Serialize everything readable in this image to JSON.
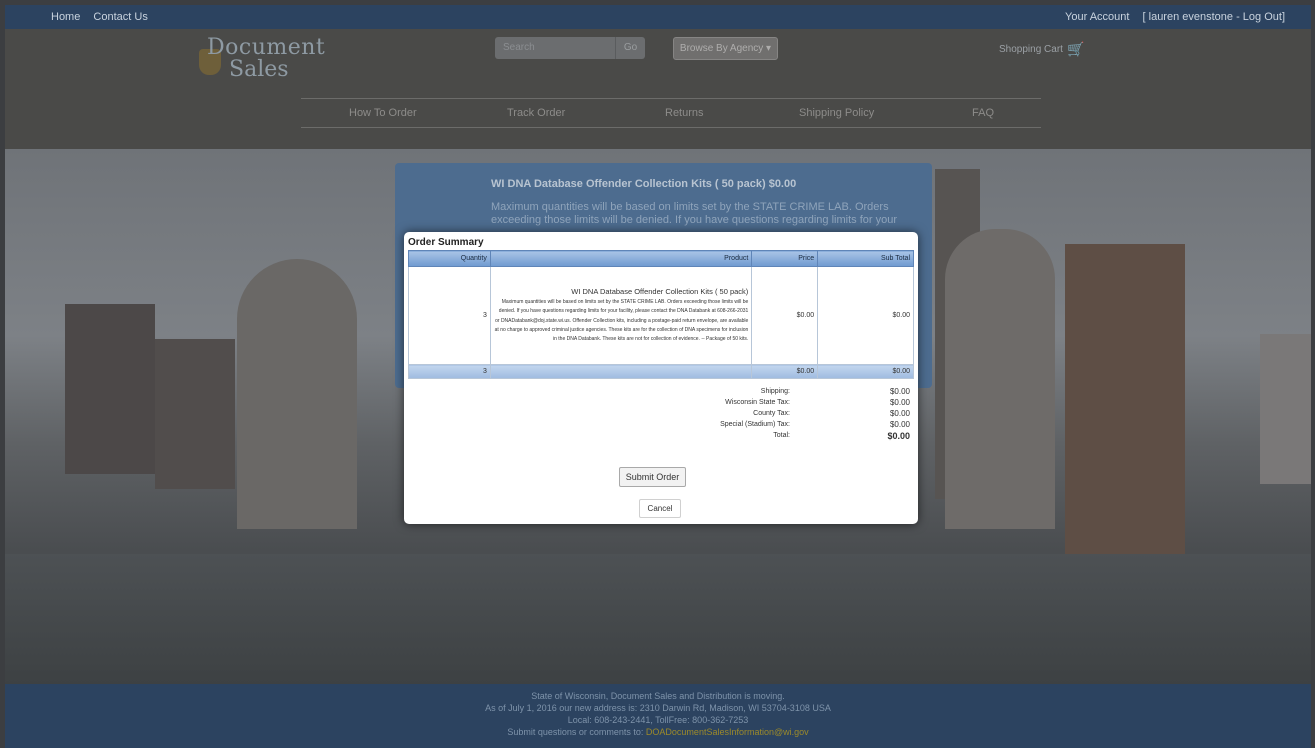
{
  "topbar": {
    "home": "Home",
    "contact": "Contact Us",
    "account": "Your Account",
    "user_logout": "[ lauren evenstone - Log Out]"
  },
  "header": {
    "logo_line1": "Document",
    "logo_line2": "Sales",
    "search_placeholder": "Search",
    "go": "Go",
    "browse": "Browse By Agency ▾",
    "cart": "Shopping Cart",
    "cart_icon": "shopping-cart-icon"
  },
  "nav": {
    "items": [
      "How To Order",
      "Track Order",
      "Returns",
      "Shipping Policy",
      "FAQ"
    ]
  },
  "product_card": {
    "title": "WI DNA Database Offender Collection Kits ( 50 pack)  $0.00",
    "desc": "Maximum quantities will be based on limits set by the STATE CRIME LAB. Orders exceeding those limits will be denied. If you have questions regarding limits for your"
  },
  "modal": {
    "title": "Order Summary",
    "headers": [
      "Quantity",
      "Product",
      "Price",
      "Sub Total"
    ],
    "item": {
      "qty": "3",
      "product_title": "WI DNA Database Offender Collection Kits ( 50 pack)",
      "description": "Maximum quantities will be based on limits set by the STATE CRIME LAB. Orders exceeding those limits will be denied. If you have questions regarding limits for your facility, please contact the DNA Databank at 608-266-2031 or DNADatabank@doj.state.wi.us. Offender Collection kits, including a postage-paid return envelope, are available at no charge to approved criminal justice agencies. These kits are for the collection of DNA specimens for inclusion in the DNA Databank. These kits are not for collection of evidence. -- Package of 50 kits.",
      "price": "$0.00",
      "subtotal": "$0.00"
    },
    "total_row": {
      "qty": "3",
      "price": "$0.00",
      "subtotal": "$0.00"
    },
    "totals": [
      {
        "label": "Shipping:",
        "value": "$0.00"
      },
      {
        "label": "Wisconsin State Tax:",
        "value": "$0.00"
      },
      {
        "label": "County Tax:",
        "value": "$0.00"
      },
      {
        "label": "Special (Stadium) Tax:",
        "value": "$0.00"
      },
      {
        "label": "Total:",
        "value": "$0.00"
      }
    ],
    "submit": "Submit Order",
    "cancel": "Cancel"
  },
  "footer": {
    "line1": "State of Wisconsin, Document Sales and Distribution is moving.",
    "line2": "As of July 1, 2016 our new address is: 2310 Darwin Rd, Madison, WI 53704-3108 USA",
    "line3": "Local: 608-243-2441, TollFree: 800-362-7253",
    "line4_prefix": "Submit questions or comments to: ",
    "email": "DOADocumentSalesInformation@wi.gov"
  }
}
